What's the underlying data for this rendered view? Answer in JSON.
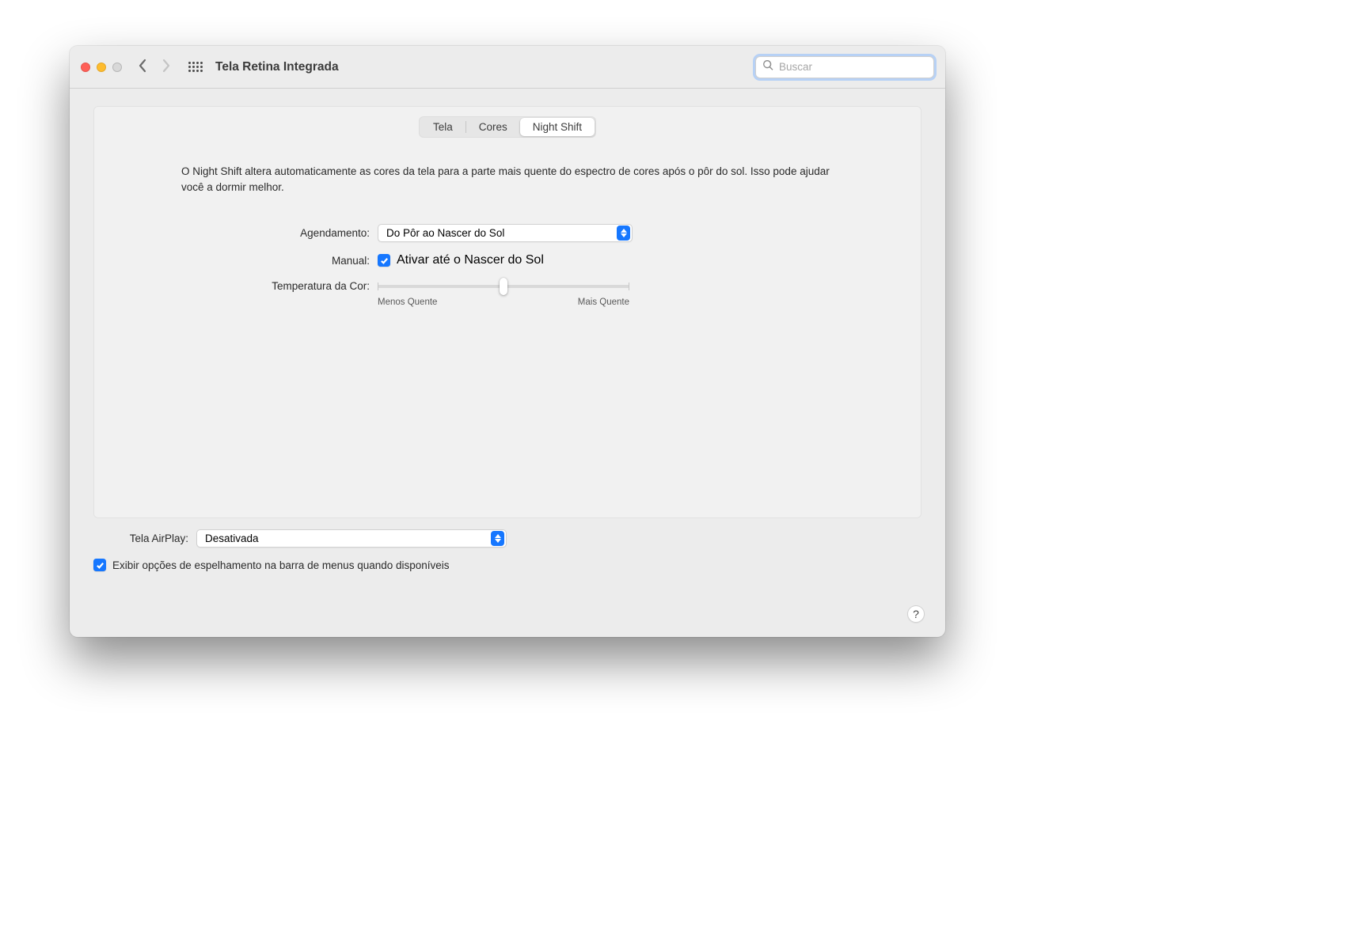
{
  "window": {
    "title": "Tela Retina Integrada",
    "search_placeholder": "Buscar"
  },
  "tabs": {
    "items": [
      "Tela",
      "Cores",
      "Night Shift"
    ],
    "active": 2
  },
  "description": "O Night Shift altera automaticamente as cores da tela para a parte mais quente do espectro de cores após o pôr do sol. Isso pode ajudar você a dormir melhor.",
  "schedule": {
    "label": "Agendamento:",
    "value": "Do Pôr ao Nascer do Sol"
  },
  "manual": {
    "label": "Manual:",
    "checkbox_label": "Ativar até o Nascer do Sol",
    "checked": true
  },
  "temperature": {
    "label": "Temperatura da Cor:",
    "min_label": "Menos Quente",
    "max_label": "Mais Quente",
    "value_percent": 50
  },
  "airplay": {
    "label": "Tela AirPlay:",
    "value": "Desativada"
  },
  "mirroring": {
    "label": "Exibir opções de espelhamento na barra de menus quando disponíveis",
    "checked": true
  },
  "help_glyph": "?"
}
